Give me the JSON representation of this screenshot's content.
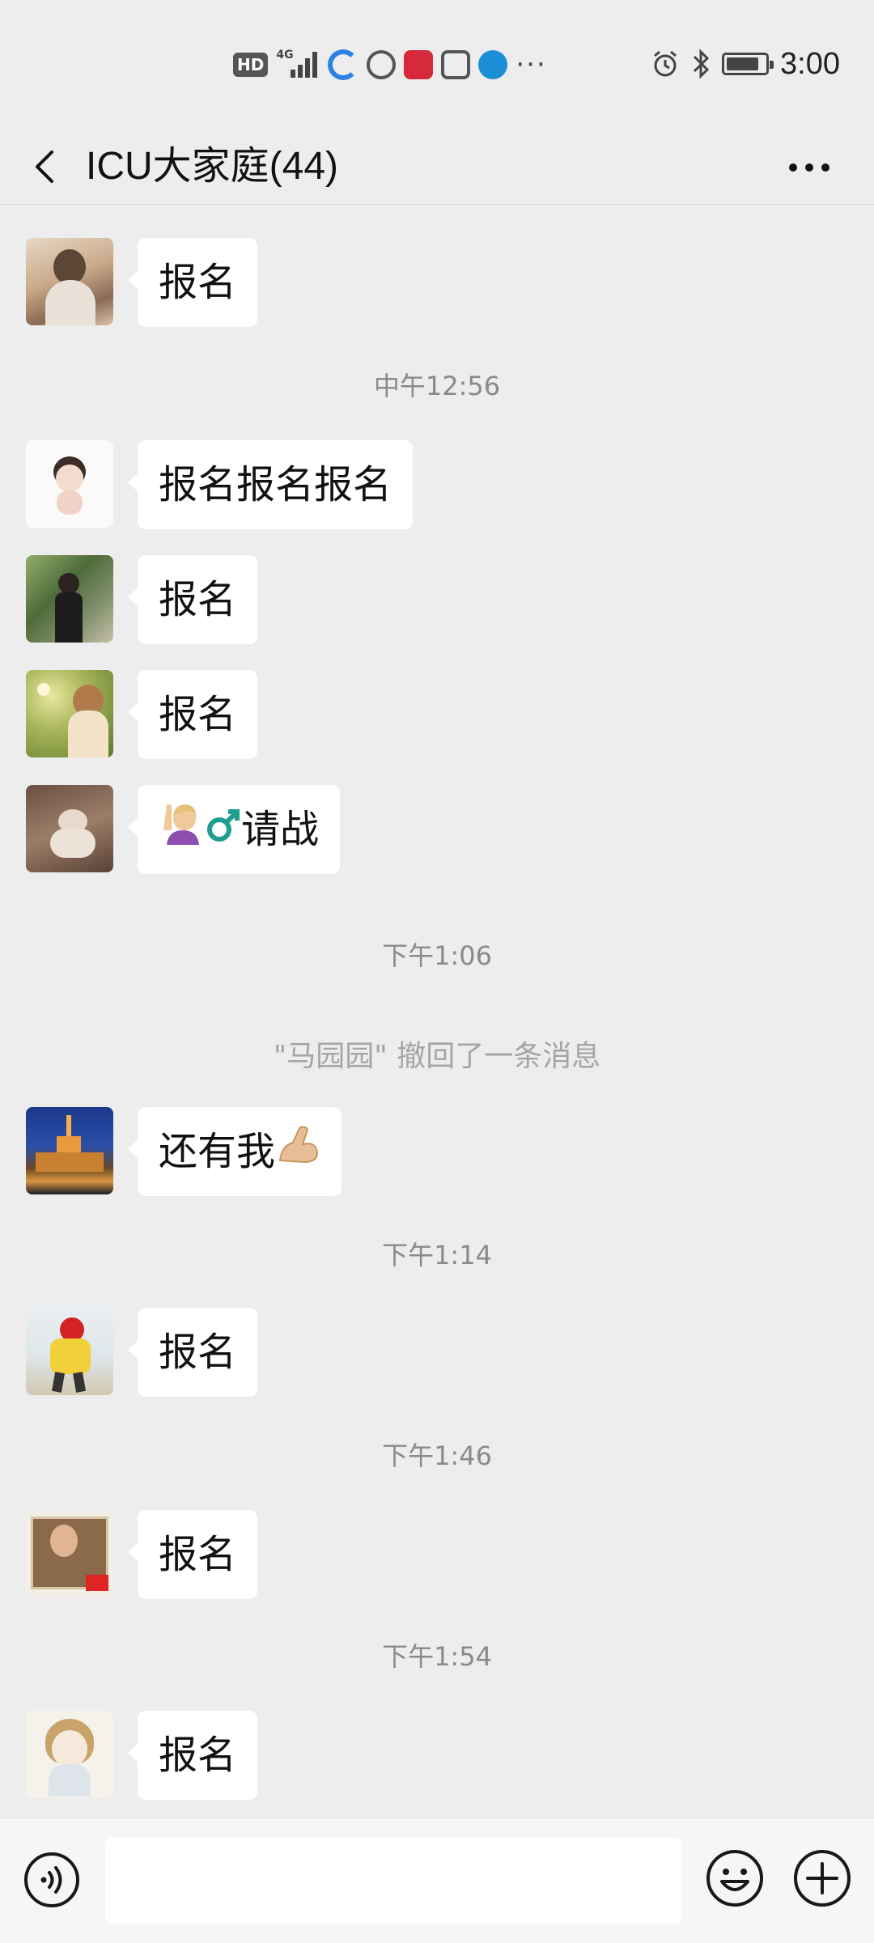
{
  "status_bar": {
    "network": "HD",
    "signal_label": "4G",
    "overflow": "···",
    "time": "3:00",
    "battery_level": 0.85
  },
  "nav": {
    "title": "ICU大家庭(44)"
  },
  "messages": [
    {
      "type": "bubble",
      "text": "报名",
      "avatar": "avatar-girl-portrait"
    },
    {
      "type": "timestamp",
      "text": "中午12:56"
    },
    {
      "type": "bubble",
      "text": "报名报名报名",
      "avatar": "avatar-cartoon-boy"
    },
    {
      "type": "bubble",
      "text": "报名",
      "avatar": "avatar-person-outdoors"
    },
    {
      "type": "bubble",
      "text": "报名",
      "avatar": "avatar-girl-flowers"
    },
    {
      "type": "bubble",
      "text": "请战",
      "emojis": [
        "🙋🏼",
        "♂"
      ],
      "avatar": "avatar-dog-photo"
    },
    {
      "type": "timestamp",
      "text": "下午1:06"
    },
    {
      "type": "system",
      "text": "\"马园园\" 撤回了一条消息"
    },
    {
      "type": "bubble",
      "text": "还有我",
      "emojis_after": [
        "💪🏼"
      ],
      "avatar": "avatar-night-cathedral"
    },
    {
      "type": "timestamp",
      "text": "下午1:14"
    },
    {
      "type": "bubble",
      "text": "报名",
      "avatar": "avatar-child-yellow"
    },
    {
      "type": "timestamp",
      "text": "下午1:46"
    },
    {
      "type": "bubble",
      "text": "报名",
      "avatar": "avatar-framed-photo"
    },
    {
      "type": "timestamp",
      "text": "下午1:54"
    },
    {
      "type": "bubble",
      "text": "报名",
      "avatar": "avatar-anime-girl"
    }
  ],
  "input_bar": {
    "value": "",
    "placeholder": ""
  },
  "colors": {
    "background": "#ededed",
    "bubble": "#ffffff",
    "timestamp": "#8a8a8a"
  }
}
